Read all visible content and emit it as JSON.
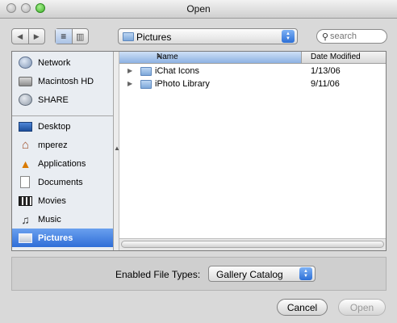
{
  "window": {
    "title": "Open"
  },
  "toolbar": {
    "nav": {
      "back": "◀",
      "forward": "▶"
    },
    "view": {
      "list": "≡",
      "columns": "▥"
    },
    "location": {
      "label": "Pictures",
      "icon": "folder-icon"
    },
    "search": {
      "placeholder": "search",
      "icon_glyph": "🔍"
    }
  },
  "sidebar": {
    "devices": [
      {
        "label": "Network",
        "icon": "globe-icon"
      },
      {
        "label": "Macintosh HD",
        "icon": "hard-drive-icon"
      },
      {
        "label": "SHARE",
        "icon": "network-share-icon"
      }
    ],
    "places": [
      {
        "label": "Desktop",
        "icon": "desktop-icon"
      },
      {
        "label": "mperez",
        "icon": "home-icon"
      },
      {
        "label": "Applications",
        "icon": "applications-icon"
      },
      {
        "label": "Documents",
        "icon": "documents-icon"
      },
      {
        "label": "Movies",
        "icon": "movies-icon"
      },
      {
        "label": "Music",
        "icon": "music-icon"
      },
      {
        "label": "Pictures",
        "icon": "pictures-icon",
        "selected": true
      }
    ]
  },
  "file_list": {
    "columns": {
      "name": "Name",
      "date": "Date Modified"
    },
    "rows": [
      {
        "name": "iChat Icons",
        "date": "1/13/06"
      },
      {
        "name": "iPhoto Library",
        "date": "9/11/06"
      }
    ]
  },
  "file_types": {
    "label": "Enabled File Types:",
    "selected": "Gallery Catalog"
  },
  "buttons": {
    "cancel": "Cancel",
    "open": "Open"
  },
  "colors": {
    "selection": "#3f7fe0",
    "sidebar_bg": "#e9edf2",
    "window_bg": "#d9d9d9"
  }
}
